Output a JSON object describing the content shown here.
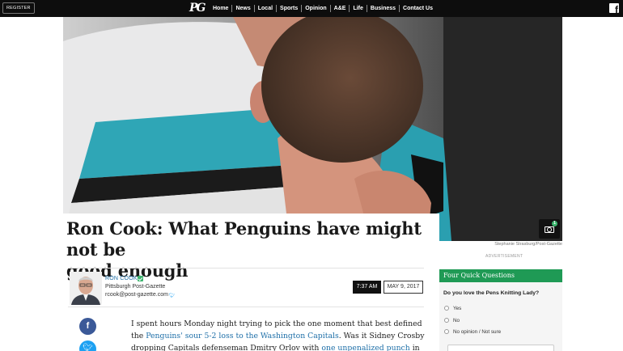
{
  "header": {
    "register_label": "REGISTER",
    "logo_text": "PG",
    "nav_items": [
      "Home",
      "News",
      "Local",
      "Sports",
      "Opinion",
      "A&E",
      "Life",
      "Business",
      "Contact Us"
    ],
    "facebook_icon": "facebook-icon"
  },
  "hero": {
    "gallery_count": "1",
    "photo_credit": "Stephanie Strasburg/Post-Gazette",
    "ad_label": "ADVERTISEMENT"
  },
  "article": {
    "headline_lines": [
      "Ron Cook: What Penguins have might not be",
      "good enough"
    ],
    "author": {
      "name": "RON COOK",
      "organization": "Pittsburgh Post-Gazette",
      "email": "rcook@post-gazette.com"
    },
    "time": "7:37 AM",
    "date": "MAY 9, 2017",
    "share": {
      "facebook": "f",
      "twitter": "t"
    },
    "body": {
      "line1": "I spent hours Monday night trying to pick the one moment that best defined",
      "line2_pre": "the ",
      "line2_link": "Penguins' sour 5-2 loss to the Washington Capitals",
      "line2_post": ". Was it Sidney Crosby",
      "line3_pre": "dropping Capitals defenseman Dmitry Orlov with ",
      "line3_link": "one unpenalized punch",
      "line3_post": " in"
    }
  },
  "poll": {
    "title": "Four Quick Questions",
    "question": "Do you love the Pens Knitting Lady?",
    "options": [
      "Yes",
      "No",
      "No opinion / Not sure"
    ]
  },
  "colors": {
    "nav_bg": "#0d0d0d",
    "link": "#1e6fa8",
    "poll_green": "#1f9a55",
    "facebook": "#3b5998",
    "twitter": "#1da1f2"
  }
}
